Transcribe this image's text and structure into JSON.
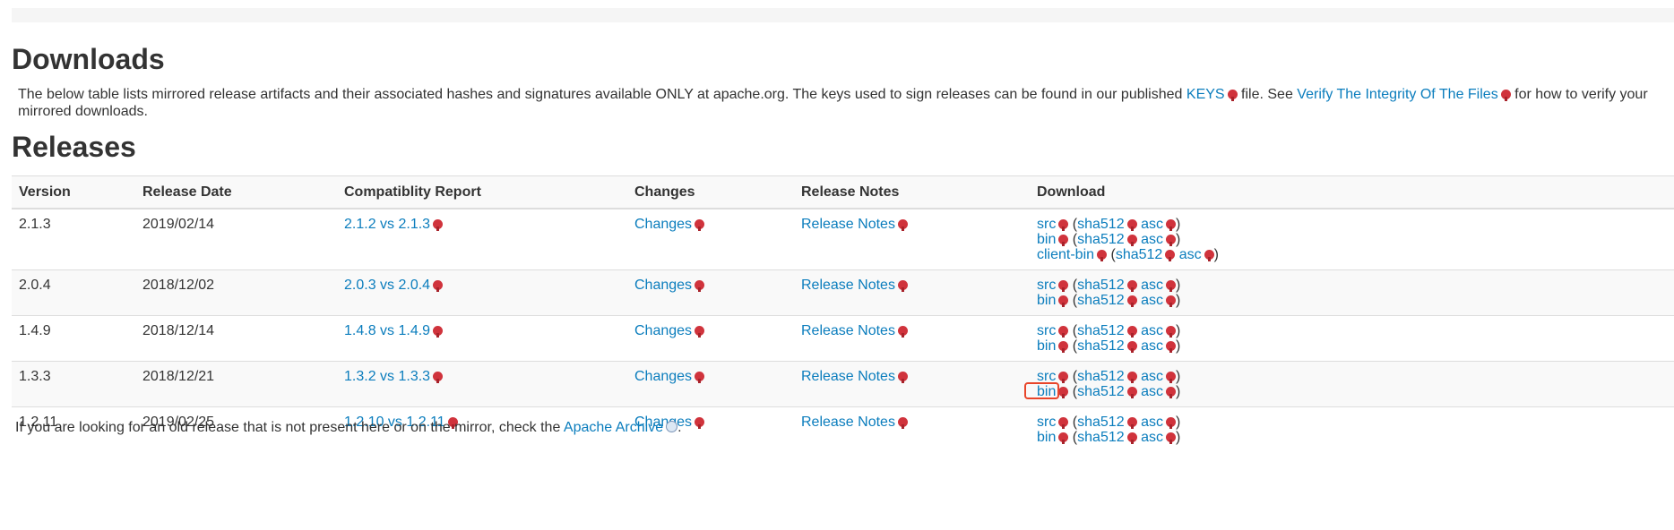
{
  "downloads": {
    "title": "Downloads",
    "intro_1": "The below table lists mirrored release artifacts and their associated hashes and signatures available ONLY at apache.org. The keys used to sign releases can be found in our published",
    "keys_link": "KEYS",
    "intro_2": "file. See",
    "verify_link": "Verify The Integrity Of The Files",
    "intro_3": "for how to verify your mirrored downloads."
  },
  "releases": {
    "title": "Releases",
    "columns": [
      "Version",
      "Release Date",
      "Compatiblity Report",
      "Changes",
      "Release Notes",
      "Download"
    ],
    "rows": [
      {
        "version": "2.1.3",
        "date": "2019/02/14",
        "compat": "2.1.2 vs 2.1.3",
        "changes": "Changes",
        "notes": "Release Notes",
        "downloads": [
          {
            "artifact": "src",
            "sha": "sha512",
            "asc": "asc"
          },
          {
            "artifact": "bin",
            "sha": "sha512",
            "asc": "asc"
          },
          {
            "artifact": "client-bin",
            "sha": "sha512",
            "asc": "asc"
          }
        ]
      },
      {
        "version": "2.0.4",
        "date": "2018/12/02",
        "compat": "2.0.3 vs 2.0.4",
        "changes": "Changes",
        "notes": "Release Notes",
        "downloads": [
          {
            "artifact": "src",
            "sha": "sha512",
            "asc": "asc"
          },
          {
            "artifact": "bin",
            "sha": "sha512",
            "asc": "asc"
          }
        ]
      },
      {
        "version": "1.4.9",
        "date": "2018/12/14",
        "compat": "1.4.8 vs 1.4.9",
        "changes": "Changes",
        "notes": "Release Notes",
        "downloads": [
          {
            "artifact": "src",
            "sha": "sha512",
            "asc": "asc"
          },
          {
            "artifact": "bin",
            "sha": "sha512",
            "asc": "asc"
          }
        ]
      },
      {
        "version": "1.3.3",
        "date": "2018/12/21",
        "compat": "1.3.2 vs 1.3.3",
        "changes": "Changes",
        "notes": "Release Notes",
        "downloads": [
          {
            "artifact": "src",
            "sha": "sha512",
            "asc": "asc"
          },
          {
            "artifact": "bin",
            "sha": "sha512",
            "asc": "asc"
          }
        ]
      },
      {
        "version": "1.2.11",
        "date": "2019/02/25",
        "compat": "1.2.10 vs 1.2.11",
        "changes": "Changes",
        "notes": "Release Notes",
        "downloads": [
          {
            "artifact": "src",
            "sha": "sha512",
            "asc": "asc"
          },
          {
            "artifact": "bin",
            "sha": "sha512",
            "asc": "asc"
          }
        ]
      }
    ]
  },
  "footer": {
    "text": "If you are looking for an old release that is not present here or on the mirror, check the",
    "archive_link": "Apache Archive",
    "period": "."
  },
  "colors": {
    "link": "#0b7dbd",
    "external_icon": "#d0333c",
    "highlight": "#e8452a"
  },
  "icons": {
    "external": "external-link-icon",
    "archive": "archive-globe-icon"
  }
}
